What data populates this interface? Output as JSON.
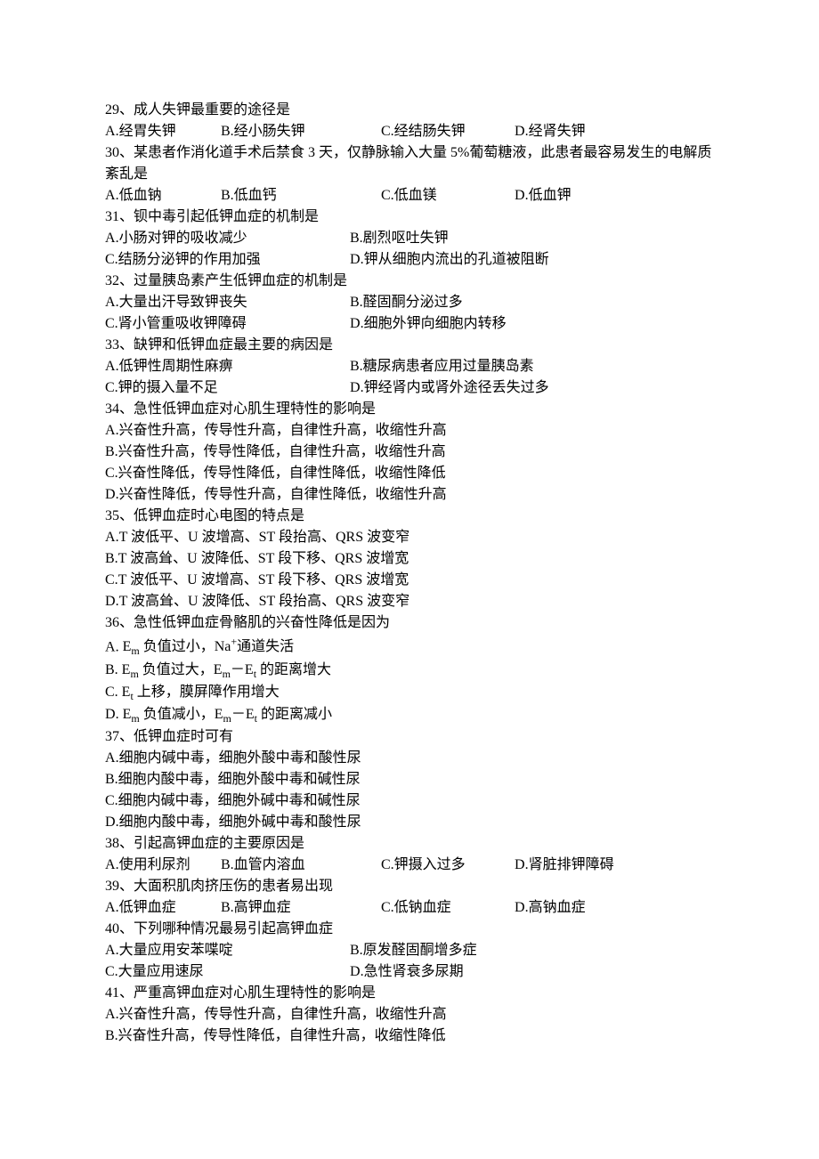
{
  "questions": [
    {
      "num": "29",
      "text": "成人失钾最重要的途径是",
      "options": [
        {
          "label": "A",
          "text": "经胃失钾"
        },
        {
          "label": "B",
          "text": "经小肠失钾"
        },
        {
          "label": "C",
          "text": "经结肠失钾"
        },
        {
          "label": "D",
          "text": "经肾失钾"
        }
      ],
      "layout": "inline4"
    },
    {
      "num": "30",
      "text": "某患者作消化道手术后禁食 3 天，仅静脉输入大量 5%葡萄糖液，此患者最容易发生的电解质紊乱是",
      "options": [
        {
          "label": "A",
          "text": "低血钠"
        },
        {
          "label": "B",
          "text": "低血钙"
        },
        {
          "label": "C",
          "text": "低血镁"
        },
        {
          "label": "D",
          "text": "低血钾"
        }
      ],
      "layout": "inline4"
    },
    {
      "num": "31",
      "text": "钡中毒引起低钾血症的机制是",
      "options": [
        {
          "label": "A",
          "text": "小肠对钾的吸收减少"
        },
        {
          "label": "B",
          "text": "剧烈呕吐失钾"
        },
        {
          "label": "C",
          "text": "结肠分泌钾的作用加强"
        },
        {
          "label": "D",
          "text": "钾从细胞内流出的孔道被阻断"
        }
      ],
      "layout": "two-col"
    },
    {
      "num": "32",
      "text": "过量胰岛素产生低钾血症的机制是",
      "options": [
        {
          "label": "A",
          "text": "大量出汗导致钾丧失"
        },
        {
          "label": "B",
          "text": "醛固酮分泌过多"
        },
        {
          "label": "C",
          "text": "肾小管重吸收钾障碍"
        },
        {
          "label": "D",
          "text": "细胞外钾向细胞内转移"
        }
      ],
      "layout": "two-col"
    },
    {
      "num": "33",
      "text": "缺钾和低钾血症最主要的病因是",
      "options": [
        {
          "label": "A",
          "text": "低钾性周期性麻痹"
        },
        {
          "label": "B",
          "text": "糖尿病患者应用过量胰岛素"
        },
        {
          "label": "C",
          "text": "钾的摄入量不足"
        },
        {
          "label": "D",
          "text": "钾经肾内或肾外途径丢失过多"
        }
      ],
      "layout": "two-col"
    },
    {
      "num": "34",
      "text": "急性低钾血症对心肌生理特性的影响是",
      "options": [
        {
          "label": "A",
          "text": "兴奋性升高，传导性升高，自律性升高，收缩性升高"
        },
        {
          "label": "B",
          "text": "兴奋性升高，传导性降低，自律性升高，收缩性升高"
        },
        {
          "label": "C",
          "text": "兴奋性降低，传导性降低，自律性降低，收缩性降低"
        },
        {
          "label": "D",
          "text": "兴奋性降低，传导性升高，自律性降低，收缩性升高"
        }
      ],
      "layout": "block"
    },
    {
      "num": "35",
      "text": "低钾血症时心电图的特点是",
      "options": [
        {
          "label": "A",
          "text": "T 波低平、U 波增高、ST 段抬高、QRS 波变窄"
        },
        {
          "label": "B",
          "text": "T 波高耸、U 波降低、ST 段下移、QRS 波增宽"
        },
        {
          "label": "C",
          "text": "T 波低平、U 波增高、ST 段下移、QRS 波增宽"
        },
        {
          "label": "D",
          "text": "T 波高耸、U 波降低、ST 段抬高、QRS 波变窄"
        }
      ],
      "layout": "block"
    },
    {
      "num": "36",
      "text": "急性低钾血症骨骼肌的兴奋性降低是因为",
      "options": [
        {
          "label": "A",
          "text_html": " E<sub>m</sub> 负值过小，Na<sup>+</sup>通道失活"
        },
        {
          "label": "B",
          "text_html": " E<sub>m</sub> 负值过大，E<sub>m</sub>－E<sub>t</sub> 的距离增大"
        },
        {
          "label": "C",
          "text_html": " E<sub>t</sub> 上移，膜屏障作用增大"
        },
        {
          "label": "D",
          "text_html": " E<sub>m</sub> 负值减小，E<sub>m</sub>－E<sub>t</sub> 的距离减小"
        }
      ],
      "layout": "block"
    },
    {
      "num": "37",
      "text": "低钾血症时可有",
      "options": [
        {
          "label": "A",
          "text": "细胞内碱中毒，细胞外酸中毒和酸性尿"
        },
        {
          "label": "B",
          "text": "细胞内酸中毒，细胞外酸中毒和碱性尿"
        },
        {
          "label": "C",
          "text": "细胞内碱中毒，细胞外碱中毒和碱性尿"
        },
        {
          "label": "D",
          "text": "细胞内酸中毒，细胞外碱中毒和酸性尿"
        }
      ],
      "layout": "block"
    },
    {
      "num": "38",
      "text": "引起高钾血症的主要原因是",
      "options": [
        {
          "label": "A",
          "text": "使用利尿剂"
        },
        {
          "label": "B",
          "text": "血管内溶血"
        },
        {
          "label": "C",
          "text": "钾摄入过多"
        },
        {
          "label": "D",
          "text": "肾脏排钾障碍"
        }
      ],
      "layout": "inline4"
    },
    {
      "num": "39",
      "text": "大面积肌肉挤压伤的患者易出现",
      "options": [
        {
          "label": "A",
          "text": "低钾血症"
        },
        {
          "label": "B",
          "text": "高钾血症"
        },
        {
          "label": "C",
          "text": "低钠血症"
        },
        {
          "label": "D",
          "text": "高钠血症"
        }
      ],
      "layout": "inline4"
    },
    {
      "num": "40",
      "text": "下列哪种情况最易引起高钾血症",
      "options": [
        {
          "label": "A",
          "text": "大量应用安苯喋啶"
        },
        {
          "label": "B",
          "text": "原发醛固酮增多症"
        },
        {
          "label": "C",
          "text": "大量应用速尿"
        },
        {
          "label": "D",
          "text": "急性肾衰多尿期"
        }
      ],
      "layout": "two-col"
    },
    {
      "num": "41",
      "text": "严重高钾血症对心肌生理特性的影响是",
      "options": [
        {
          "label": "A",
          "text": "兴奋性升高，传导性升高，自律性升高，收缩性升高"
        },
        {
          "label": "B",
          "text": "兴奋性升高，传导性降低，自律性升高，收缩性降低"
        }
      ],
      "layout": "block"
    }
  ]
}
